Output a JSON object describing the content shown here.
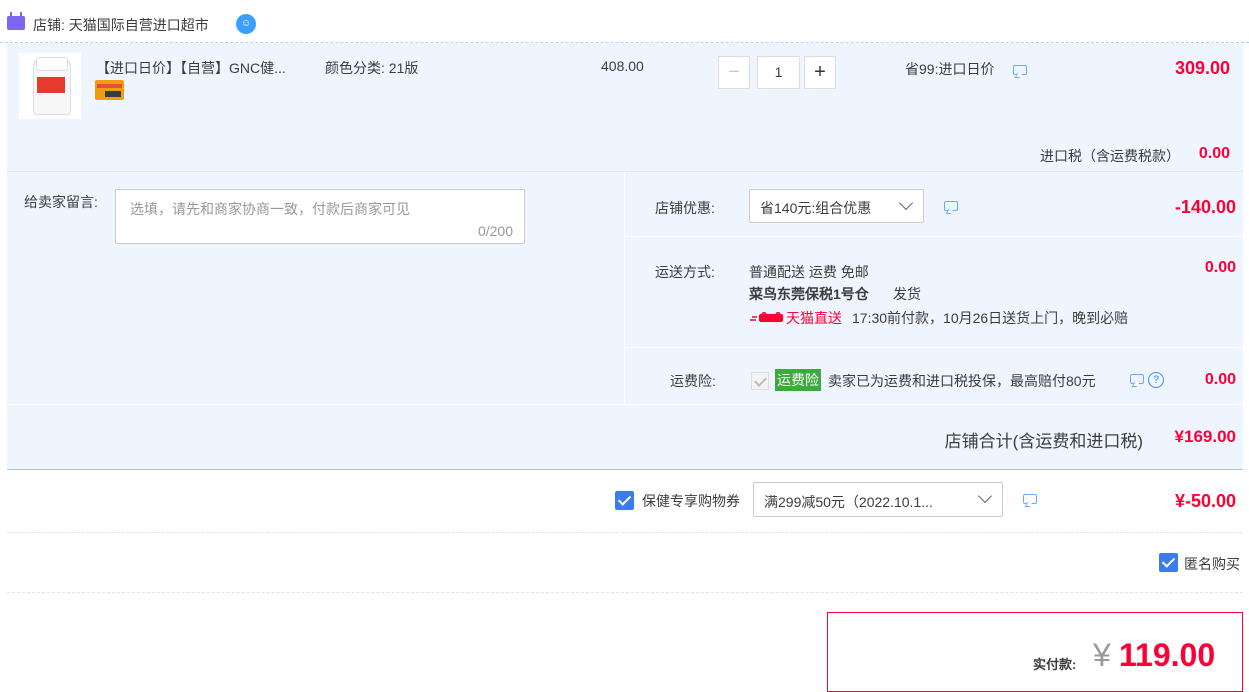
{
  "shop": {
    "icon": "tmall-cat-icon",
    "label": "店铺: 天猫国际自营进口超市",
    "badge_icon": "wangwang-chat-icon"
  },
  "item": {
    "title": "【进口日价】【自营】GNC健...",
    "spec": "颜色分类: 21版",
    "unit_price": "408.00",
    "quantity": "1",
    "promo": "省99:进口日价",
    "total": "309.00",
    "thumb_icon": "gnc-coq10-bottle-image",
    "badge_icon": "credit-card-icon"
  },
  "tax": {
    "label": "进口税（含运费税款）",
    "value": "0.00"
  },
  "message": {
    "label": "给卖家留言:",
    "placeholder": "选填，请先和商家协商一致，付款后商家可见",
    "count": "0/200"
  },
  "shop_coupon": {
    "label": "店铺优惠:",
    "selected": "省140元:组合优惠",
    "value": "-140.00"
  },
  "shipping": {
    "label": "运送方式:",
    "method": "普通配送 运费 免邮",
    "warehouse": "菜鸟东莞保税1号仓",
    "send": "发货",
    "express": "天猫直送",
    "time_note": "17:30前付款，10月26日送货上门，晚到必赔",
    "value": "0.00"
  },
  "insurance": {
    "label": "运费险:",
    "tag": "运费险",
    "desc": "卖家已为运费和进口税投保，最高赔付80元",
    "help": "?",
    "value": "0.00"
  },
  "subtotal": {
    "label": "店铺合计(含运费和进口税)",
    "value": "¥169.00"
  },
  "voucher": {
    "label": "保健专享购物券",
    "selected": "满299减50元（2022.10.1...",
    "value": "¥-50.00"
  },
  "anonymous": {
    "label": "匿名购买"
  },
  "payment": {
    "label": "实付款:",
    "currency": "¥",
    "value": "119.00"
  },
  "colors": {
    "accent": "#ff0036",
    "pane": "#eef5ff",
    "checkbox": "#3a7cf0",
    "insurance_tag": "#3caa3c"
  }
}
